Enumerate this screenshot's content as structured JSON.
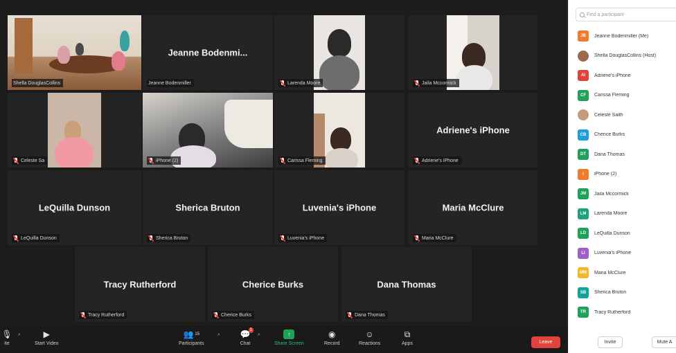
{
  "tiles": [
    {
      "name": "Celeste Saith",
      "label": "Shella DouglasCollins",
      "type": "video",
      "active": true
    },
    {
      "name": "Jeanne  Bodenmi...",
      "label": "Jeanne Bodenmiller",
      "type": "name"
    },
    {
      "name": "Larenda Moore",
      "label": "Larenda Moore",
      "type": "video"
    },
    {
      "name": "Jaila Mccormick",
      "label": "Jaila Mccormick",
      "type": "video"
    },
    {
      "name": "Celeste Saith",
      "label": "Celeste Sa",
      "type": "video"
    },
    {
      "name": "iPhone",
      "label": "iPhone (2)",
      "type": "video"
    },
    {
      "name": "Carissa Fleming",
      "label": "Carissa Fleming",
      "type": "video"
    },
    {
      "name": "Adriene's iPhone",
      "label": "Adriene's iPhone",
      "type": "name"
    },
    {
      "name": "LeQuilla Dunson",
      "label": "LeQuilla Dunson",
      "type": "name"
    },
    {
      "name": "Sherica Bruton",
      "label": "Sherica Bruton",
      "type": "name"
    },
    {
      "name": "Luvenia's iPhone",
      "label": "Luvenia's iPhone",
      "type": "name"
    },
    {
      "name": "Maria McClure",
      "label": "Maria McClure",
      "type": "name"
    },
    {
      "name": "Tracy Rutherford",
      "label": "Tracy Rutherford",
      "type": "name"
    },
    {
      "name": "Cherice Burks",
      "label": "Cherice Burks",
      "type": "name"
    },
    {
      "name": "Dana Thomas",
      "label": "Dana Thomas",
      "type": "name"
    }
  ],
  "toolbar": {
    "mute_label": "ite",
    "video_label": "Start Video",
    "participants_label": "Participants",
    "participants_count": "15",
    "chat_label": "Chat",
    "chat_badge": "1",
    "share_label": "Share Screen",
    "record_label": "Record",
    "reactions_label": "Reactions",
    "apps_label": "Apps",
    "leave_label": "Leave"
  },
  "panel": {
    "search_placeholder": "Find a participant",
    "participants": [
      {
        "initials": "JB",
        "name": "Jeanne Bodenmiller (Me)",
        "color": "#f07a2e",
        "photo": false
      },
      {
        "initials": "",
        "name": "Shella DouglasCollins (Host)",
        "color": "#9b6a4c",
        "photo": true
      },
      {
        "initials": "AI",
        "name": "Adriene's iPhone",
        "color": "#e0433b",
        "photo": false
      },
      {
        "initials": "CF",
        "name": "Carissa Fleming",
        "color": "#1fa15a",
        "photo": false
      },
      {
        "initials": "",
        "name": "Celeste Saith",
        "color": "#c49a7a",
        "photo": true
      },
      {
        "initials": "CB",
        "name": "Cherice Burks",
        "color": "#1e9fd8",
        "photo": false
      },
      {
        "initials": "DT",
        "name": "Dana Thomas",
        "color": "#1fa15a",
        "photo": false
      },
      {
        "initials": "I",
        "name": "iPhone (2)",
        "color": "#f07a2e",
        "photo": false
      },
      {
        "initials": "JM",
        "name": "Jaila Mccormick",
        "color": "#1fa15a",
        "photo": false
      },
      {
        "initials": "LM",
        "name": "Larenda Moore",
        "color": "#1fa17a",
        "photo": false
      },
      {
        "initials": "LD",
        "name": "LeQuilla Dunson",
        "color": "#1fa15a",
        "photo": false
      },
      {
        "initials": "LI",
        "name": "Luvenia's iPhone",
        "color": "#a05ec8",
        "photo": false
      },
      {
        "initials": "MM",
        "name": "Maria McClure",
        "color": "#f2b72c",
        "photo": false
      },
      {
        "initials": "SB",
        "name": "Sherica Bruton",
        "color": "#12a39a",
        "photo": false
      },
      {
        "initials": "TR",
        "name": "Tracy Rutherford",
        "color": "#1fa15a",
        "photo": false
      }
    ],
    "invite_label": "Invite",
    "mute_all_label": "Mute A"
  }
}
